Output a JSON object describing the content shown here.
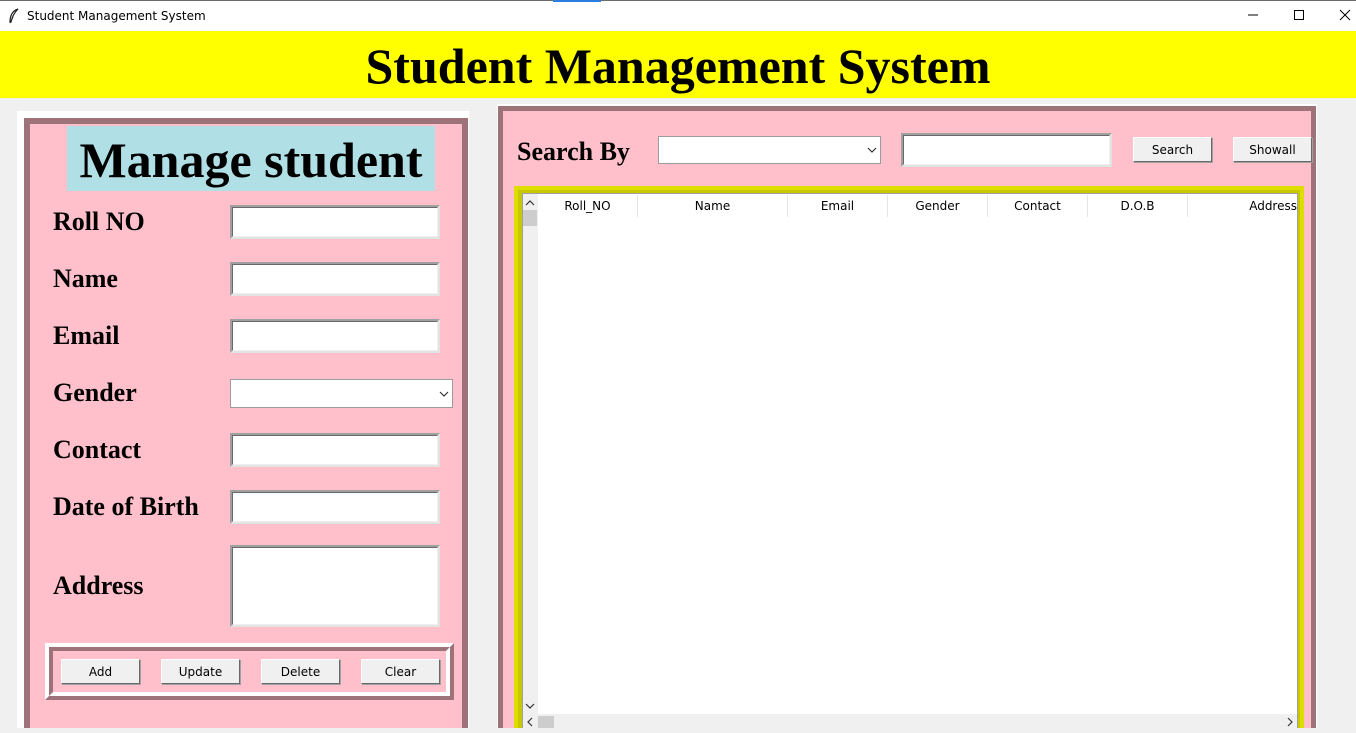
{
  "window": {
    "title": "Student Management System",
    "minimize_icon": "minimize-icon",
    "maximize_icon": "maximize-icon",
    "close_icon": "close-icon"
  },
  "header": {
    "title": "Student Management System"
  },
  "manage": {
    "title": "Manage student",
    "fields": {
      "roll_no": {
        "label": "Roll NO",
        "value": ""
      },
      "name": {
        "label": "Name",
        "value": ""
      },
      "email": {
        "label": "Email",
        "value": ""
      },
      "gender": {
        "label": "Gender",
        "selected": ""
      },
      "contact": {
        "label": "Contact",
        "value": ""
      },
      "dob": {
        "label": "Date of Birth",
        "value": ""
      },
      "address": {
        "label": "Address",
        "value": ""
      }
    },
    "buttons": {
      "add": "Add",
      "update": "Update",
      "delete": "Delete",
      "clear": "Clear"
    }
  },
  "search": {
    "label": "Search By",
    "by_selected": "",
    "query": "",
    "search_button": "Search",
    "showall_button": "Showall"
  },
  "table": {
    "columns": [
      "Roll_NO",
      "Name",
      "Email",
      "Gender",
      "Contact",
      "D.O.B",
      "Address"
    ],
    "rows": []
  },
  "colors": {
    "header_bg": "#ffff00",
    "panel_bg": "#ffc0cb",
    "title_bg": "#b0e0e6",
    "panel_border": "#9d7278",
    "table_border": "#dddd00"
  }
}
